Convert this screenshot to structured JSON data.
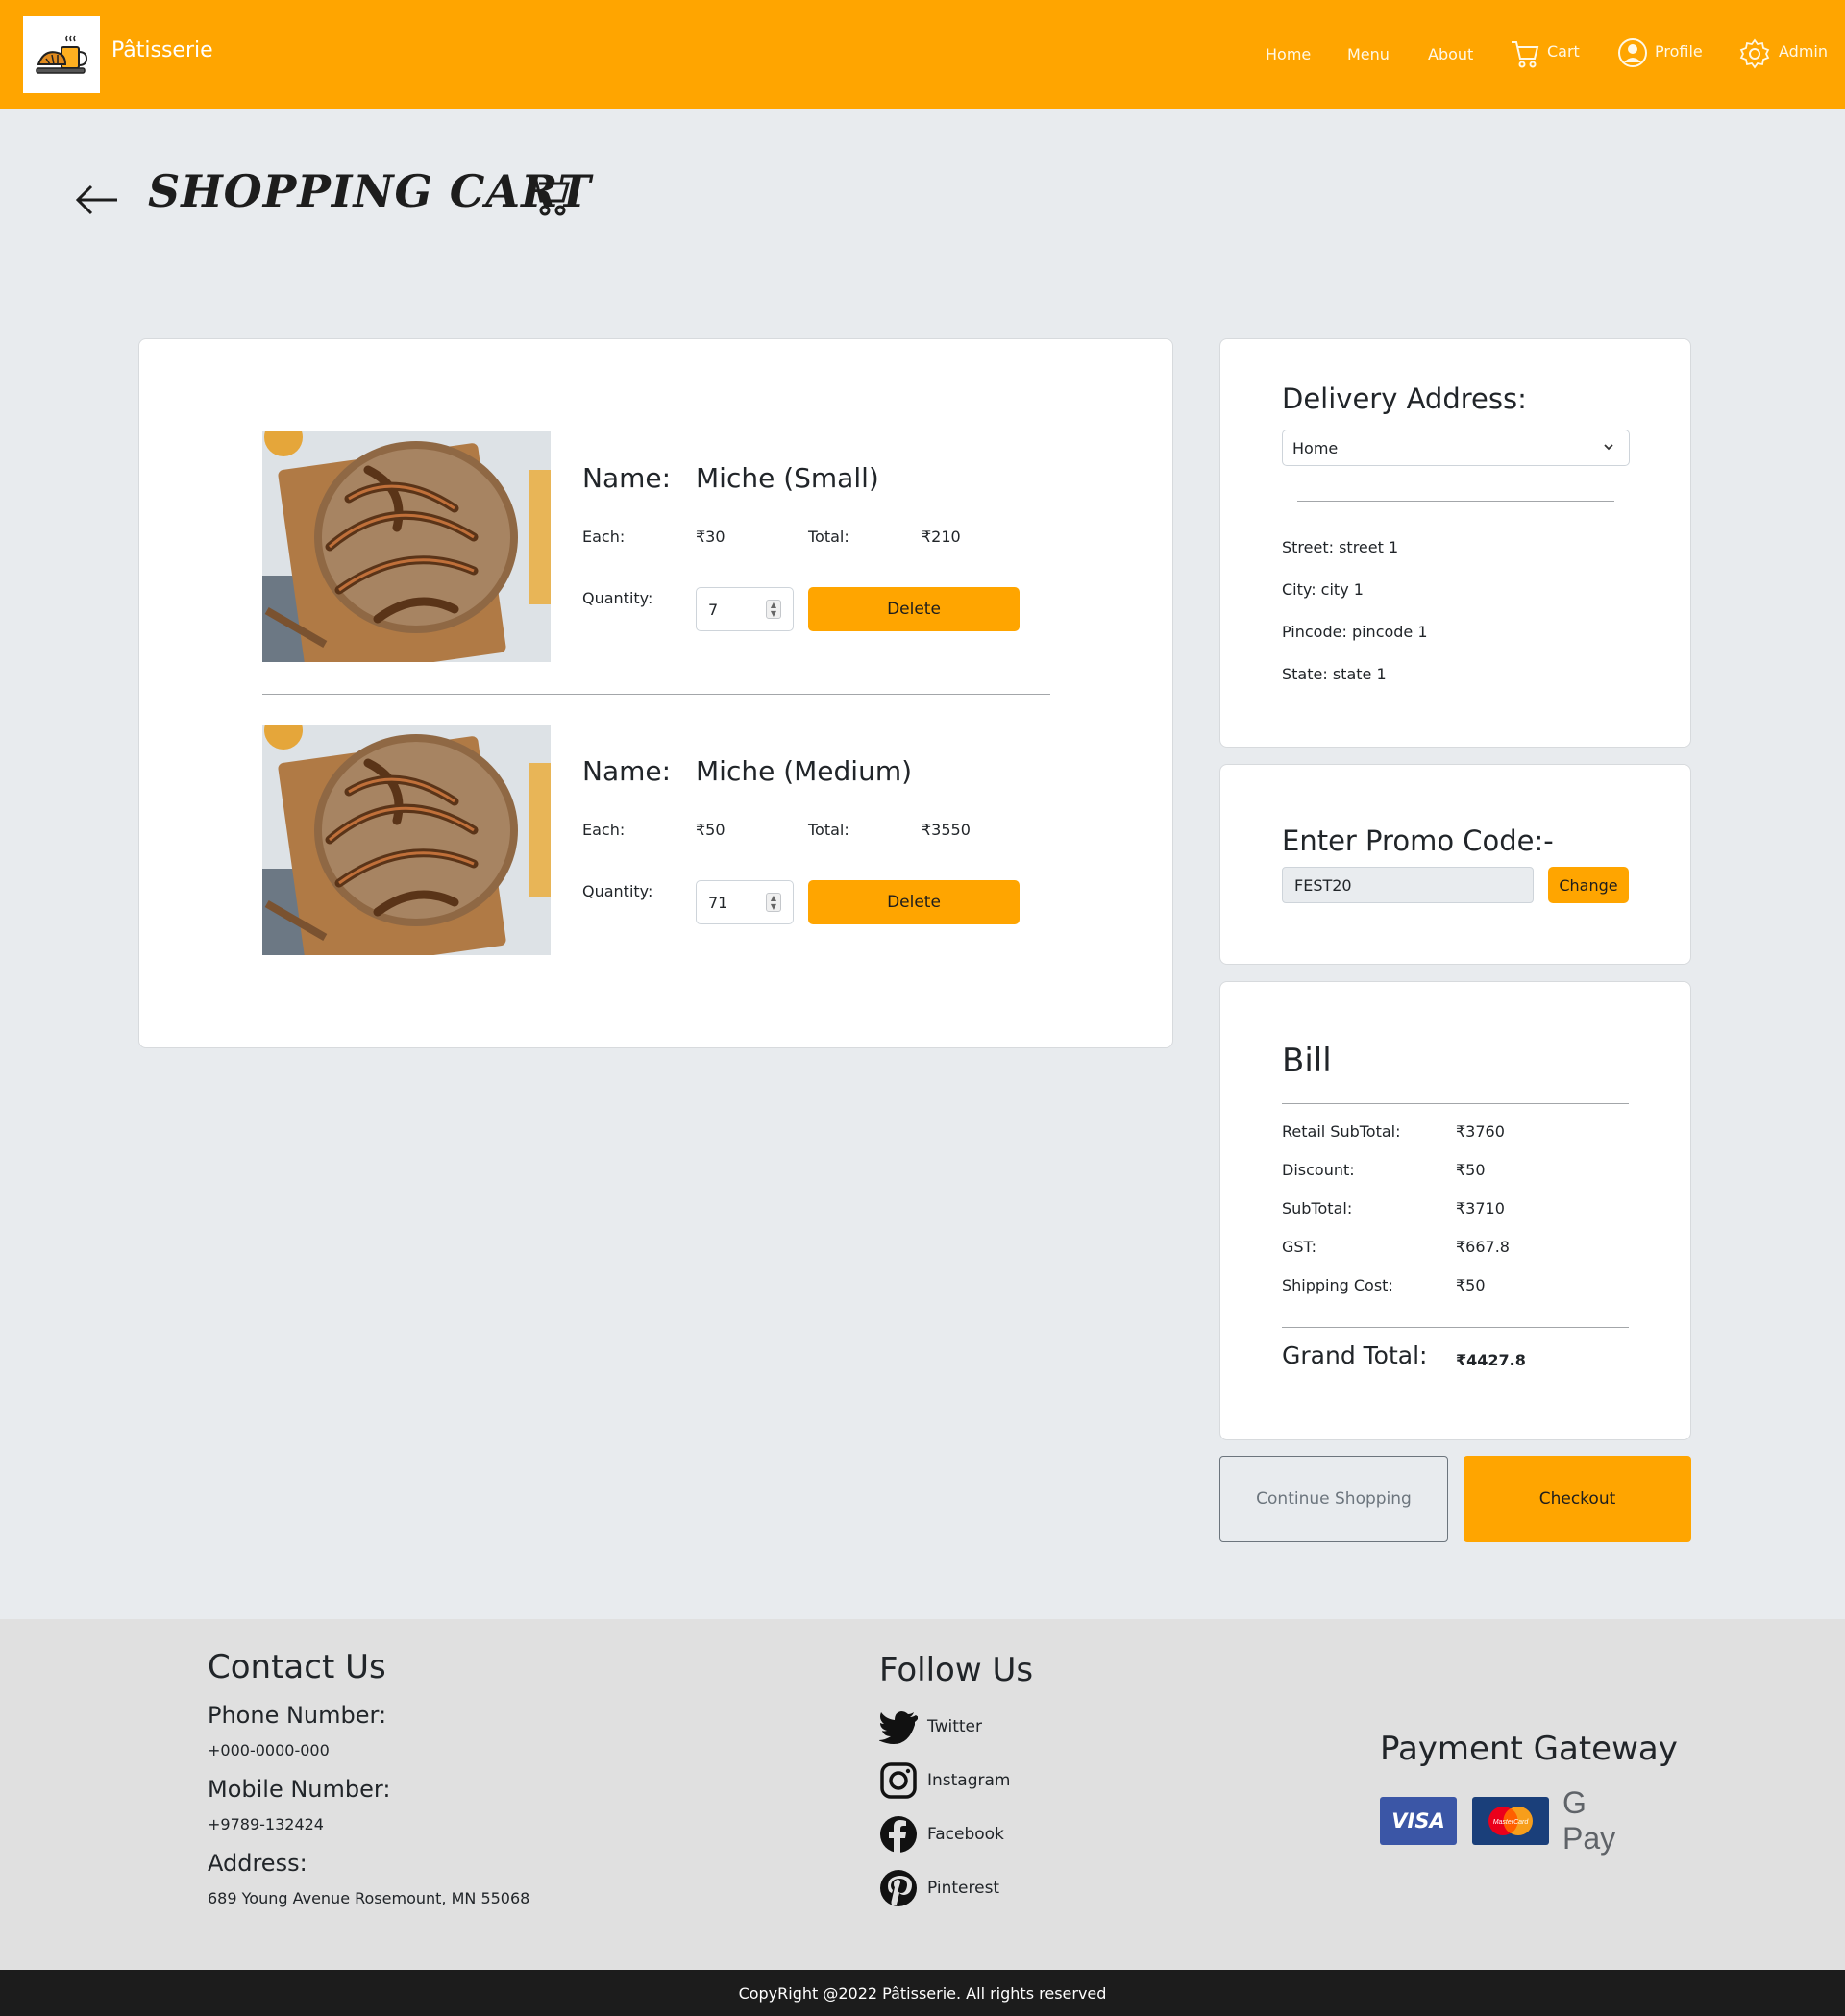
{
  "nav": {
    "brand": "Pâtisserie",
    "links": [
      "Home",
      "Menu",
      "About"
    ],
    "cart": "Cart",
    "profile": "Profile",
    "admin": "Admin"
  },
  "page": {
    "title": "SHOPPING CART"
  },
  "cart_items": [
    {
      "name_label": "Name:",
      "name": "Miche (Small)",
      "each_label": "Each:",
      "each": "₹30",
      "total_label": "Total:",
      "total": "₹210",
      "qty_label": "Quantity:",
      "qty": "7",
      "delete": "Delete"
    },
    {
      "name_label": "Name:",
      "name": "Miche (Medium)",
      "each_label": "Each:",
      "each": "₹50",
      "total_label": "Total:",
      "total": "₹3550",
      "qty_label": "Quantity:",
      "qty": "71",
      "delete": "Delete"
    }
  ],
  "delivery": {
    "title": "Delivery Address:",
    "selected": "Home",
    "street": "Street: street 1",
    "city": "City: city 1",
    "pincode": "Pincode: pincode 1",
    "state": "State: state 1"
  },
  "promo": {
    "title": "Enter Promo Code:-",
    "code": "FEST20",
    "button": "Change"
  },
  "bill": {
    "title": "Bill",
    "rows": [
      {
        "label": "Retail SubTotal:",
        "value": "₹3760"
      },
      {
        "label": "Discount:",
        "value": "₹50"
      },
      {
        "label": "SubTotal:",
        "value": "₹3710"
      },
      {
        "label": "GST:",
        "value": "₹667.8"
      },
      {
        "label": "Shipping Cost:",
        "value": "₹50"
      }
    ],
    "grand_label": "Grand Total:",
    "grand_value": "₹4427.8"
  },
  "actions": {
    "continue": "Continue Shopping",
    "checkout": "Checkout"
  },
  "footer": {
    "contact_title": "Contact Us",
    "phone_label": "Phone Number:",
    "phone": "+000-0000-000",
    "mobile_label": "Mobile Number:",
    "mobile": "+9789-132424",
    "address_label": "Address:",
    "address": "689 Young Avenue Rosemount, MN 55068",
    "follow_title": "Follow Us",
    "social": [
      "Twitter",
      "Instagram",
      "Facebook",
      "Pinterest"
    ],
    "payment_title": "Payment Gateway",
    "payment_methods": [
      "VISA",
      "MasterCard",
      "G Pay"
    ],
    "copyright": "CopyRight @2022 Pâtisserie. All rights reserved"
  },
  "colors": {
    "accent": "#ffa500",
    "background": "#e8ebee",
    "footer": "#e0e0e0",
    "bottom_bar": "#1c1c1c"
  }
}
